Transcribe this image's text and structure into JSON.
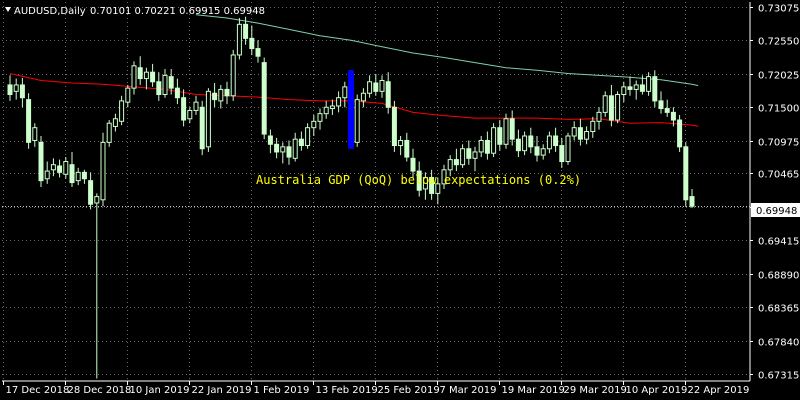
{
  "header": {
    "symbol_timeframe": "AUDUSD,Daily",
    "ohlc": "0.70101 0.70221 0.69915 0.69948"
  },
  "colors": {
    "background": "#000000",
    "grid": "#c0c0c0",
    "axis": "#ffffff",
    "candle": "#ccffcc",
    "ma_fast": "#ff0000",
    "ma_slow": "#7fd0a8",
    "event_bar": "#0000ff",
    "annotation": "#ffff00",
    "current_price_line": "#c0c0c0"
  },
  "chart_data": {
    "type": "candlestick",
    "y_ticks": [
      "0.67315",
      "0.67840",
      "0.68365",
      "0.68890",
      "0.69415",
      "0.69940",
      "0.70465",
      "0.70975",
      "0.71500",
      "0.72025",
      "0.72550",
      "0.73075"
    ],
    "ylim": [
      0.6721,
      0.7315
    ],
    "x_labels": [
      "17 Dec 2018",
      "28 Dec 2018",
      "10 Jan 2019",
      "22 Jan 2019",
      "1 Feb 2019",
      "13 Feb 2019",
      "25 Feb 2019",
      "7 Mar 2019",
      "19 Mar 2019",
      "29 Mar 2019",
      "10 Apr 2019",
      "22 Apr 2019"
    ],
    "x_label_index": [
      0,
      10,
      20,
      30,
      40,
      50,
      60,
      70,
      80,
      90,
      100,
      110
    ],
    "current_price": "0.69948",
    "annotation": "Australia GDP (QoQ) below expectations (0.2%)",
    "event_bar": {
      "index": 55,
      "low": 0.7085,
      "high": 0.7208
    },
    "candles": [
      {
        "o": 0.7185,
        "h": 0.72,
        "l": 0.716,
        "c": 0.717
      },
      {
        "o": 0.7175,
        "h": 0.7195,
        "l": 0.7162,
        "c": 0.7185
      },
      {
        "o": 0.7185,
        "h": 0.7196,
        "l": 0.715,
        "c": 0.7165
      },
      {
        "o": 0.7162,
        "h": 0.7172,
        "l": 0.7085,
        "c": 0.7095
      },
      {
        "o": 0.7098,
        "h": 0.7125,
        "l": 0.7088,
        "c": 0.7118
      },
      {
        "o": 0.7095,
        "h": 0.7105,
        "l": 0.7025,
        "c": 0.7035
      },
      {
        "o": 0.7038,
        "h": 0.7065,
        "l": 0.703,
        "c": 0.705
      },
      {
        "o": 0.7052,
        "h": 0.707,
        "l": 0.7042,
        "c": 0.706
      },
      {
        "o": 0.7058,
        "h": 0.7068,
        "l": 0.704,
        "c": 0.7048
      },
      {
        "o": 0.7045,
        "h": 0.7072,
        "l": 0.7038,
        "c": 0.7065
      },
      {
        "o": 0.706,
        "h": 0.708,
        "l": 0.7025,
        "c": 0.7032
      },
      {
        "o": 0.7035,
        "h": 0.7055,
        "l": 0.7028,
        "c": 0.7048
      },
      {
        "o": 0.7048,
        "h": 0.7052,
        "l": 0.703,
        "c": 0.7038
      },
      {
        "o": 0.7035,
        "h": 0.7048,
        "l": 0.699,
        "c": 0.6998
      },
      {
        "o": 0.7,
        "h": 0.7015,
        "l": 0.6725,
        "c": 0.701
      },
      {
        "o": 0.7005,
        "h": 0.711,
        "l": 0.6995,
        "c": 0.7095
      },
      {
        "o": 0.7095,
        "h": 0.713,
        "l": 0.7088,
        "c": 0.7125
      },
      {
        "o": 0.712,
        "h": 0.714,
        "l": 0.7112,
        "c": 0.7132
      },
      {
        "o": 0.7128,
        "h": 0.7168,
        "l": 0.7122,
        "c": 0.716
      },
      {
        "o": 0.7158,
        "h": 0.7185,
        "l": 0.715,
        "c": 0.718
      },
      {
        "o": 0.718,
        "h": 0.7222,
        "l": 0.717,
        "c": 0.7215
      },
      {
        "o": 0.7212,
        "h": 0.723,
        "l": 0.7185,
        "c": 0.7195
      },
      {
        "o": 0.7195,
        "h": 0.7212,
        "l": 0.7178,
        "c": 0.7205
      },
      {
        "o": 0.7205,
        "h": 0.7218,
        "l": 0.7182,
        "c": 0.719
      },
      {
        "o": 0.719,
        "h": 0.7205,
        "l": 0.716,
        "c": 0.717
      },
      {
        "o": 0.717,
        "h": 0.721,
        "l": 0.7165,
        "c": 0.72
      },
      {
        "o": 0.7198,
        "h": 0.721,
        "l": 0.717,
        "c": 0.718
      },
      {
        "o": 0.718,
        "h": 0.7195,
        "l": 0.7155,
        "c": 0.7165
      },
      {
        "o": 0.7165,
        "h": 0.7178,
        "l": 0.712,
        "c": 0.713
      },
      {
        "o": 0.7132,
        "h": 0.715,
        "l": 0.7125,
        "c": 0.7145
      },
      {
        "o": 0.7145,
        "h": 0.7168,
        "l": 0.7138,
        "c": 0.7158
      },
      {
        "o": 0.715,
        "h": 0.716,
        "l": 0.7075,
        "c": 0.7085
      },
      {
        "o": 0.7088,
        "h": 0.718,
        "l": 0.708,
        "c": 0.7175
      },
      {
        "o": 0.7172,
        "h": 0.7188,
        "l": 0.715,
        "c": 0.7162
      },
      {
        "o": 0.716,
        "h": 0.7185,
        "l": 0.7148,
        "c": 0.7178
      },
      {
        "o": 0.7178,
        "h": 0.719,
        "l": 0.7155,
        "c": 0.7168
      },
      {
        "o": 0.7168,
        "h": 0.724,
        "l": 0.716,
        "c": 0.7232
      },
      {
        "o": 0.7232,
        "h": 0.729,
        "l": 0.7225,
        "c": 0.728
      },
      {
        "o": 0.728,
        "h": 0.7292,
        "l": 0.7248,
        "c": 0.7258
      },
      {
        "o": 0.7258,
        "h": 0.7278,
        "l": 0.7232,
        "c": 0.7242
      },
      {
        "o": 0.7242,
        "h": 0.7255,
        "l": 0.722,
        "c": 0.723
      },
      {
        "o": 0.722,
        "h": 0.7228,
        "l": 0.71,
        "c": 0.7108
      },
      {
        "o": 0.7105,
        "h": 0.7115,
        "l": 0.7078,
        "c": 0.7092
      },
      {
        "o": 0.7092,
        "h": 0.7102,
        "l": 0.707,
        "c": 0.708
      },
      {
        "o": 0.708,
        "h": 0.7095,
        "l": 0.7062,
        "c": 0.7088
      },
      {
        "o": 0.7088,
        "h": 0.7098,
        "l": 0.706,
        "c": 0.7072
      },
      {
        "o": 0.707,
        "h": 0.711,
        "l": 0.7065,
        "c": 0.71
      },
      {
        "o": 0.71,
        "h": 0.7112,
        "l": 0.7082,
        "c": 0.709
      },
      {
        "o": 0.709,
        "h": 0.7125,
        "l": 0.7085,
        "c": 0.7118
      },
      {
        "o": 0.7118,
        "h": 0.7138,
        "l": 0.7105,
        "c": 0.7128
      },
      {
        "o": 0.7128,
        "h": 0.7148,
        "l": 0.7115,
        "c": 0.714
      },
      {
        "o": 0.714,
        "h": 0.716,
        "l": 0.7132,
        "c": 0.715
      },
      {
        "o": 0.7148,
        "h": 0.7162,
        "l": 0.7138,
        "c": 0.7152
      },
      {
        "o": 0.7152,
        "h": 0.7175,
        "l": 0.7142,
        "c": 0.7165
      },
      {
        "o": 0.7165,
        "h": 0.719,
        "l": 0.715,
        "c": 0.7182
      },
      {
        "o": 0.718,
        "h": 0.7208,
        "l": 0.7085,
        "c": 0.7095
      },
      {
        "o": 0.7095,
        "h": 0.717,
        "l": 0.7088,
        "c": 0.7162
      },
      {
        "o": 0.716,
        "h": 0.718,
        "l": 0.715,
        "c": 0.7172
      },
      {
        "o": 0.7172,
        "h": 0.72,
        "l": 0.7165,
        "c": 0.719
      },
      {
        "o": 0.7188,
        "h": 0.7202,
        "l": 0.7168,
        "c": 0.7175
      },
      {
        "o": 0.7175,
        "h": 0.72,
        "l": 0.7165,
        "c": 0.7192
      },
      {
        "o": 0.719,
        "h": 0.7205,
        "l": 0.714,
        "c": 0.715
      },
      {
        "o": 0.715,
        "h": 0.716,
        "l": 0.708,
        "c": 0.709
      },
      {
        "o": 0.709,
        "h": 0.7105,
        "l": 0.7075,
        "c": 0.7098
      },
      {
        "o": 0.7098,
        "h": 0.711,
        "l": 0.7065,
        "c": 0.7072
      },
      {
        "o": 0.707,
        "h": 0.7085,
        "l": 0.704,
        "c": 0.705
      },
      {
        "o": 0.705,
        "h": 0.7065,
        "l": 0.701,
        "c": 0.702
      },
      {
        "o": 0.7022,
        "h": 0.7048,
        "l": 0.7005,
        "c": 0.704
      },
      {
        "o": 0.704,
        "h": 0.7052,
        "l": 0.7005,
        "c": 0.7015
      },
      {
        "o": 0.7015,
        "h": 0.704,
        "l": 0.6998,
        "c": 0.703
      },
      {
        "o": 0.703,
        "h": 0.706,
        "l": 0.7022,
        "c": 0.7052
      },
      {
        "o": 0.7052,
        "h": 0.7075,
        "l": 0.7042,
        "c": 0.7068
      },
      {
        "o": 0.7068,
        "h": 0.7085,
        "l": 0.705,
        "c": 0.706
      },
      {
        "o": 0.706,
        "h": 0.7092,
        "l": 0.7055,
        "c": 0.7085
      },
      {
        "o": 0.7085,
        "h": 0.7098,
        "l": 0.706,
        "c": 0.707
      },
      {
        "o": 0.707,
        "h": 0.7088,
        "l": 0.705,
        "c": 0.708
      },
      {
        "o": 0.708,
        "h": 0.7105,
        "l": 0.7072,
        "c": 0.7098
      },
      {
        "o": 0.7098,
        "h": 0.7112,
        "l": 0.7068,
        "c": 0.7078
      },
      {
        "o": 0.7078,
        "h": 0.7125,
        "l": 0.7072,
        "c": 0.7118
      },
      {
        "o": 0.7118,
        "h": 0.713,
        "l": 0.7082,
        "c": 0.7092
      },
      {
        "o": 0.7092,
        "h": 0.714,
        "l": 0.7085,
        "c": 0.7132
      },
      {
        "o": 0.7132,
        "h": 0.7145,
        "l": 0.709,
        "c": 0.71
      },
      {
        "o": 0.71,
        "h": 0.7115,
        "l": 0.7072,
        "c": 0.7082
      },
      {
        "o": 0.7082,
        "h": 0.7112,
        "l": 0.7075,
        "c": 0.7105
      },
      {
        "o": 0.7105,
        "h": 0.7118,
        "l": 0.7078,
        "c": 0.7088
      },
      {
        "o": 0.7088,
        "h": 0.7105,
        "l": 0.7065,
        "c": 0.7075
      },
      {
        "o": 0.7075,
        "h": 0.7092,
        "l": 0.7068,
        "c": 0.7085
      },
      {
        "o": 0.7085,
        "h": 0.7112,
        "l": 0.7078,
        "c": 0.7105
      },
      {
        "o": 0.7105,
        "h": 0.7118,
        "l": 0.708,
        "c": 0.709
      },
      {
        "o": 0.709,
        "h": 0.7102,
        "l": 0.7055,
        "c": 0.7065
      },
      {
        "o": 0.7065,
        "h": 0.711,
        "l": 0.706,
        "c": 0.7105
      },
      {
        "o": 0.7105,
        "h": 0.7128,
        "l": 0.7098,
        "c": 0.7118
      },
      {
        "o": 0.7118,
        "h": 0.7132,
        "l": 0.709,
        "c": 0.71
      },
      {
        "o": 0.71,
        "h": 0.712,
        "l": 0.7092,
        "c": 0.7112
      },
      {
        "o": 0.7112,
        "h": 0.7135,
        "l": 0.7102,
        "c": 0.7128
      },
      {
        "o": 0.7128,
        "h": 0.715,
        "l": 0.7115,
        "c": 0.7142
      },
      {
        "o": 0.7142,
        "h": 0.7175,
        "l": 0.7135,
        "c": 0.7168
      },
      {
        "o": 0.7168,
        "h": 0.7185,
        "l": 0.712,
        "c": 0.713
      },
      {
        "o": 0.713,
        "h": 0.7175,
        "l": 0.7125,
        "c": 0.717
      },
      {
        "o": 0.717,
        "h": 0.719,
        "l": 0.7158,
        "c": 0.7182
      },
      {
        "o": 0.7182,
        "h": 0.7198,
        "l": 0.7168,
        "c": 0.7178
      },
      {
        "o": 0.7178,
        "h": 0.7192,
        "l": 0.7162,
        "c": 0.7185
      },
      {
        "o": 0.7185,
        "h": 0.72,
        "l": 0.717,
        "c": 0.7175
      },
      {
        "o": 0.7175,
        "h": 0.7205,
        "l": 0.7168,
        "c": 0.7198
      },
      {
        "o": 0.7198,
        "h": 0.7208,
        "l": 0.715,
        "c": 0.716
      },
      {
        "o": 0.716,
        "h": 0.7175,
        "l": 0.714,
        "c": 0.7148
      },
      {
        "o": 0.7148,
        "h": 0.7162,
        "l": 0.7135,
        "c": 0.7142
      },
      {
        "o": 0.7142,
        "h": 0.715,
        "l": 0.712,
        "c": 0.713
      },
      {
        "o": 0.713,
        "h": 0.7138,
        "l": 0.708,
        "c": 0.7088
      },
      {
        "o": 0.7088,
        "h": 0.7095,
        "l": 0.6995,
        "c": 0.7005
      },
      {
        "o": 0.701,
        "h": 0.7022,
        "l": 0.6992,
        "c": 0.6995
      }
    ],
    "ma_fast": [
      [
        0,
        0.7203
      ],
      [
        5,
        0.7192
      ],
      [
        10,
        0.7188
      ],
      [
        15,
        0.7186
      ],
      [
        20,
        0.7182
      ],
      [
        25,
        0.7178
      ],
      [
        30,
        0.717
      ],
      [
        35,
        0.7168
      ],
      [
        40,
        0.7166
      ],
      [
        45,
        0.7162
      ],
      [
        50,
        0.716
      ],
      [
        55,
        0.716
      ],
      [
        60,
        0.7156
      ],
      [
        65,
        0.7142
      ],
      [
        70,
        0.7137
      ],
      [
        75,
        0.7133
      ],
      [
        80,
        0.7133
      ],
      [
        85,
        0.7133
      ],
      [
        90,
        0.7131
      ],
      [
        95,
        0.7132
      ],
      [
        100,
        0.7125
      ],
      [
        105,
        0.7126
      ],
      [
        110,
        0.7122
      ],
      [
        111,
        0.712
      ]
    ],
    "ma_slow": [
      [
        30,
        0.7295
      ],
      [
        35,
        0.729
      ],
      [
        40,
        0.7282
      ],
      [
        45,
        0.7272
      ],
      [
        50,
        0.7262
      ],
      [
        55,
        0.7255
      ],
      [
        60,
        0.7245
      ],
      [
        65,
        0.7235
      ],
      [
        70,
        0.7228
      ],
      [
        75,
        0.722
      ],
      [
        80,
        0.7212
      ],
      [
        85,
        0.7208
      ],
      [
        90,
        0.7203
      ],
      [
        95,
        0.72
      ],
      [
        100,
        0.7197
      ],
      [
        105,
        0.7193
      ],
      [
        110,
        0.7186
      ],
      [
        111,
        0.7184
      ]
    ]
  }
}
